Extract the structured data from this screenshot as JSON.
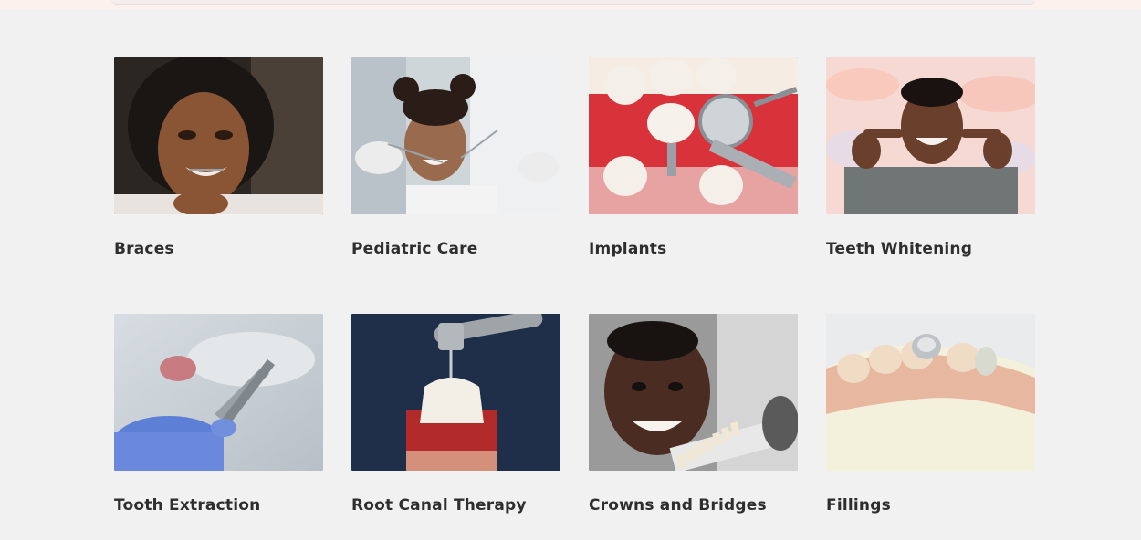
{
  "services": [
    {
      "title": "Braces",
      "image": "smiling-woman-with-braces"
    },
    {
      "title": "Pediatric Care",
      "image": "child-at-dentist"
    },
    {
      "title": "Implants",
      "image": "dental-implant-illustration"
    },
    {
      "title": "Teeth Whitening",
      "image": "man-pointing-at-smile"
    },
    {
      "title": "Tooth Extraction",
      "image": "gloved-hand-with-extraction-forceps"
    },
    {
      "title": "Root Canal Therapy",
      "image": "root-canal-drill-illustration"
    },
    {
      "title": "Crowns and Bridges",
      "image": "man-with-shade-guide"
    },
    {
      "title": "Fillings",
      "image": "dental-model-with-crown"
    }
  ]
}
